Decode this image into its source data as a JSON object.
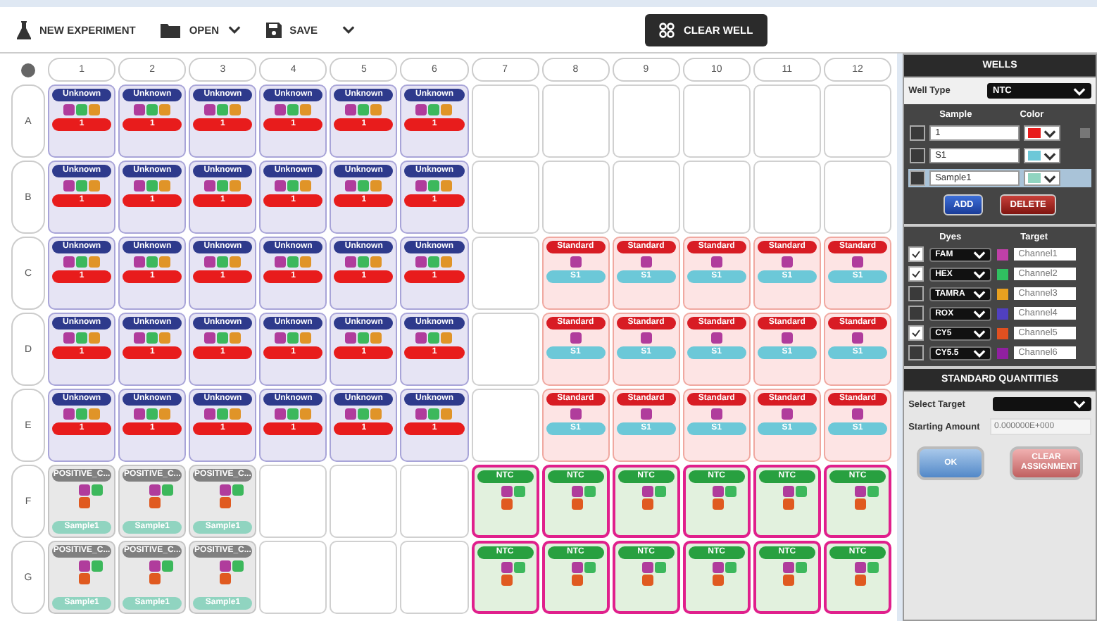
{
  "toolbar": {
    "new_experiment": "NEW EXPERIMENT",
    "open": "OPEN",
    "save": "SAVE",
    "clear_well": "CLEAR WELL"
  },
  "plate": {
    "columns": [
      "1",
      "2",
      "3",
      "4",
      "5",
      "6",
      "7",
      "8",
      "9",
      "10",
      "11",
      "12"
    ],
    "rows": [
      {
        "label": "A",
        "wells": [
          {
            "kind": "unknown",
            "label": "Unknown",
            "dyes": [
              {
                "color": "#b03c9c"
              },
              {
                "color": "#3cb85c"
              },
              {
                "color": "#e09428"
              }
            ],
            "tag": "1"
          },
          {
            "kind": "unknown",
            "label": "Unknown",
            "dyes": [
              {
                "color": "#b03c9c"
              },
              {
                "color": "#3cb85c"
              },
              {
                "color": "#e09428"
              }
            ],
            "tag": "1"
          },
          {
            "kind": "unknown",
            "label": "Unknown",
            "dyes": [
              {
                "color": "#b03c9c"
              },
              {
                "color": "#3cb85c"
              },
              {
                "color": "#e09428"
              }
            ],
            "tag": "1"
          },
          {
            "kind": "unknown",
            "label": "Unknown",
            "dyes": [
              {
                "color": "#b03c9c"
              },
              {
                "color": "#3cb85c"
              },
              {
                "color": "#e09428"
              }
            ],
            "tag": "1"
          },
          {
            "kind": "unknown",
            "label": "Unknown",
            "dyes": [
              {
                "color": "#b03c9c"
              },
              {
                "color": "#3cb85c"
              },
              {
                "color": "#e09428"
              }
            ],
            "tag": "1"
          },
          {
            "kind": "unknown",
            "label": "Unknown",
            "dyes": [
              {
                "color": "#b03c9c"
              },
              {
                "color": "#3cb85c"
              },
              {
                "color": "#e09428"
              }
            ],
            "tag": "1"
          },
          {
            "kind": "empty"
          },
          {
            "kind": "empty"
          },
          {
            "kind": "empty"
          },
          {
            "kind": "empty"
          },
          {
            "kind": "empty"
          },
          {
            "kind": "empty"
          }
        ]
      },
      {
        "label": "B",
        "wells": [
          {
            "kind": "unknown",
            "label": "Unknown",
            "dyes": [
              {
                "color": "#b03c9c"
              },
              {
                "color": "#3cb85c"
              },
              {
                "color": "#e09428"
              }
            ],
            "tag": "1"
          },
          {
            "kind": "unknown",
            "label": "Unknown",
            "dyes": [
              {
                "color": "#b03c9c"
              },
              {
                "color": "#3cb85c"
              },
              {
                "color": "#e09428"
              }
            ],
            "tag": "1"
          },
          {
            "kind": "unknown",
            "label": "Unknown",
            "dyes": [
              {
                "color": "#b03c9c"
              },
              {
                "color": "#3cb85c"
              },
              {
                "color": "#e09428"
              }
            ],
            "tag": "1"
          },
          {
            "kind": "unknown",
            "label": "Unknown",
            "dyes": [
              {
                "color": "#b03c9c"
              },
              {
                "color": "#3cb85c"
              },
              {
                "color": "#e09428"
              }
            ],
            "tag": "1"
          },
          {
            "kind": "unknown",
            "label": "Unknown",
            "dyes": [
              {
                "color": "#b03c9c"
              },
              {
                "color": "#3cb85c"
              },
              {
                "color": "#e09428"
              }
            ],
            "tag": "1"
          },
          {
            "kind": "unknown",
            "label": "Unknown",
            "dyes": [
              {
                "color": "#b03c9c"
              },
              {
                "color": "#3cb85c"
              },
              {
                "color": "#e09428"
              }
            ],
            "tag": "1"
          },
          {
            "kind": "empty"
          },
          {
            "kind": "empty"
          },
          {
            "kind": "empty"
          },
          {
            "kind": "empty"
          },
          {
            "kind": "empty"
          },
          {
            "kind": "empty"
          }
        ]
      },
      {
        "label": "C",
        "wells": [
          {
            "kind": "unknown",
            "label": "Unknown",
            "dyes": [
              {
                "color": "#b03c9c"
              },
              {
                "color": "#3cb85c"
              },
              {
                "color": "#e09428"
              }
            ],
            "tag": "1"
          },
          {
            "kind": "unknown",
            "label": "Unknown",
            "dyes": [
              {
                "color": "#b03c9c"
              },
              {
                "color": "#3cb85c"
              },
              {
                "color": "#e09428"
              }
            ],
            "tag": "1"
          },
          {
            "kind": "unknown",
            "label": "Unknown",
            "dyes": [
              {
                "color": "#b03c9c"
              },
              {
                "color": "#3cb85c"
              },
              {
                "color": "#e09428"
              }
            ],
            "tag": "1"
          },
          {
            "kind": "unknown",
            "label": "Unknown",
            "dyes": [
              {
                "color": "#b03c9c"
              },
              {
                "color": "#3cb85c"
              },
              {
                "color": "#e09428"
              }
            ],
            "tag": "1"
          },
          {
            "kind": "unknown",
            "label": "Unknown",
            "dyes": [
              {
                "color": "#b03c9c"
              },
              {
                "color": "#3cb85c"
              },
              {
                "color": "#e09428"
              }
            ],
            "tag": "1"
          },
          {
            "kind": "unknown",
            "label": "Unknown",
            "dyes": [
              {
                "color": "#b03c9c"
              },
              {
                "color": "#3cb85c"
              },
              {
                "color": "#e09428"
              }
            ],
            "tag": "1"
          },
          {
            "kind": "empty"
          },
          {
            "kind": "standard",
            "label": "Standard",
            "dyes": [
              {
                "color": "#b03c9c"
              }
            ],
            "tag": "S1"
          },
          {
            "kind": "standard",
            "label": "Standard",
            "dyes": [
              {
                "color": "#b03c9c"
              }
            ],
            "tag": "S1"
          },
          {
            "kind": "standard",
            "label": "Standard",
            "dyes": [
              {
                "color": "#b03c9c"
              }
            ],
            "tag": "S1"
          },
          {
            "kind": "standard",
            "label": "Standard",
            "dyes": [
              {
                "color": "#b03c9c"
              }
            ],
            "tag": "S1"
          },
          {
            "kind": "standard",
            "label": "Standard",
            "dyes": [
              {
                "color": "#b03c9c"
              }
            ],
            "tag": "S1"
          }
        ]
      },
      {
        "label": "D",
        "wells": [
          {
            "kind": "unknown",
            "label": "Unknown",
            "dyes": [
              {
                "color": "#b03c9c"
              },
              {
                "color": "#3cb85c"
              },
              {
                "color": "#e09428"
              }
            ],
            "tag": "1"
          },
          {
            "kind": "unknown",
            "label": "Unknown",
            "dyes": [
              {
                "color": "#b03c9c"
              },
              {
                "color": "#3cb85c"
              },
              {
                "color": "#e09428"
              }
            ],
            "tag": "1"
          },
          {
            "kind": "unknown",
            "label": "Unknown",
            "dyes": [
              {
                "color": "#b03c9c"
              },
              {
                "color": "#3cb85c"
              },
              {
                "color": "#e09428"
              }
            ],
            "tag": "1"
          },
          {
            "kind": "unknown",
            "label": "Unknown",
            "dyes": [
              {
                "color": "#b03c9c"
              },
              {
                "color": "#3cb85c"
              },
              {
                "color": "#e09428"
              }
            ],
            "tag": "1"
          },
          {
            "kind": "unknown",
            "label": "Unknown",
            "dyes": [
              {
                "color": "#b03c9c"
              },
              {
                "color": "#3cb85c"
              },
              {
                "color": "#e09428"
              }
            ],
            "tag": "1"
          },
          {
            "kind": "unknown",
            "label": "Unknown",
            "dyes": [
              {
                "color": "#b03c9c"
              },
              {
                "color": "#3cb85c"
              },
              {
                "color": "#e09428"
              }
            ],
            "tag": "1"
          },
          {
            "kind": "empty"
          },
          {
            "kind": "standard",
            "label": "Standard",
            "dyes": [
              {
                "color": "#b03c9c"
              }
            ],
            "tag": "S1"
          },
          {
            "kind": "standard",
            "label": "Standard",
            "dyes": [
              {
                "color": "#b03c9c"
              }
            ],
            "tag": "S1"
          },
          {
            "kind": "standard",
            "label": "Standard",
            "dyes": [
              {
                "color": "#b03c9c"
              }
            ],
            "tag": "S1"
          },
          {
            "kind": "standard",
            "label": "Standard",
            "dyes": [
              {
                "color": "#b03c9c"
              }
            ],
            "tag": "S1"
          },
          {
            "kind": "standard",
            "label": "Standard",
            "dyes": [
              {
                "color": "#b03c9c"
              }
            ],
            "tag": "S1"
          }
        ]
      },
      {
        "label": "E",
        "wells": [
          {
            "kind": "unknown",
            "label": "Unknown",
            "dyes": [
              {
                "color": "#b03c9c"
              },
              {
                "color": "#3cb85c"
              },
              {
                "color": "#e09428"
              }
            ],
            "tag": "1"
          },
          {
            "kind": "unknown",
            "label": "Unknown",
            "dyes": [
              {
                "color": "#b03c9c"
              },
              {
                "color": "#3cb85c"
              },
              {
                "color": "#e09428"
              }
            ],
            "tag": "1"
          },
          {
            "kind": "unknown",
            "label": "Unknown",
            "dyes": [
              {
                "color": "#b03c9c"
              },
              {
                "color": "#3cb85c"
              },
              {
                "color": "#e09428"
              }
            ],
            "tag": "1"
          },
          {
            "kind": "unknown",
            "label": "Unknown",
            "dyes": [
              {
                "color": "#b03c9c"
              },
              {
                "color": "#3cb85c"
              },
              {
                "color": "#e09428"
              }
            ],
            "tag": "1"
          },
          {
            "kind": "unknown",
            "label": "Unknown",
            "dyes": [
              {
                "color": "#b03c9c"
              },
              {
                "color": "#3cb85c"
              },
              {
                "color": "#e09428"
              }
            ],
            "tag": "1"
          },
          {
            "kind": "unknown",
            "label": "Unknown",
            "dyes": [
              {
                "color": "#b03c9c"
              },
              {
                "color": "#3cb85c"
              },
              {
                "color": "#e09428"
              }
            ],
            "tag": "1"
          },
          {
            "kind": "empty"
          },
          {
            "kind": "standard",
            "label": "Standard",
            "dyes": [
              {
                "color": "#b03c9c"
              }
            ],
            "tag": "S1"
          },
          {
            "kind": "standard",
            "label": "Standard",
            "dyes": [
              {
                "color": "#b03c9c"
              }
            ],
            "tag": "S1"
          },
          {
            "kind": "standard",
            "label": "Standard",
            "dyes": [
              {
                "color": "#b03c9c"
              }
            ],
            "tag": "S1"
          },
          {
            "kind": "standard",
            "label": "Standard",
            "dyes": [
              {
                "color": "#b03c9c"
              }
            ],
            "tag": "S1"
          },
          {
            "kind": "standard",
            "label": "Standard",
            "dyes": [
              {
                "color": "#b03c9c"
              }
            ],
            "tag": "S1"
          }
        ]
      },
      {
        "label": "F",
        "wells": [
          {
            "kind": "positive",
            "label": "POSITIVE_C...",
            "dyes": [
              {
                "color": "#b03c9c"
              },
              {
                "color": "#3cb85c"
              },
              {
                "color": "#e05a20"
              }
            ],
            "tag": "Sample1"
          },
          {
            "kind": "positive",
            "label": "POSITIVE_C...",
            "dyes": [
              {
                "color": "#b03c9c"
              },
              {
                "color": "#3cb85c"
              },
              {
                "color": "#e05a20"
              }
            ],
            "tag": "Sample1"
          },
          {
            "kind": "positive",
            "label": "POSITIVE_C...",
            "dyes": [
              {
                "color": "#b03c9c"
              },
              {
                "color": "#3cb85c"
              },
              {
                "color": "#e05a20"
              }
            ],
            "tag": "Sample1"
          },
          {
            "kind": "empty"
          },
          {
            "kind": "empty"
          },
          {
            "kind": "empty"
          },
          {
            "kind": "ntc",
            "label": "NTC",
            "dyes": [
              {
                "color": "#b03c9c"
              },
              {
                "color": "#3cb85c"
              },
              {
                "color": "#e05a20"
              }
            ]
          },
          {
            "kind": "ntc",
            "label": "NTC",
            "dyes": [
              {
                "color": "#b03c9c"
              },
              {
                "color": "#3cb85c"
              },
              {
                "color": "#e05a20"
              }
            ]
          },
          {
            "kind": "ntc",
            "label": "NTC",
            "dyes": [
              {
                "color": "#b03c9c"
              },
              {
                "color": "#3cb85c"
              },
              {
                "color": "#e05a20"
              }
            ]
          },
          {
            "kind": "ntc",
            "label": "NTC",
            "dyes": [
              {
                "color": "#b03c9c"
              },
              {
                "color": "#3cb85c"
              },
              {
                "color": "#e05a20"
              }
            ]
          },
          {
            "kind": "ntc",
            "label": "NTC",
            "dyes": [
              {
                "color": "#b03c9c"
              },
              {
                "color": "#3cb85c"
              },
              {
                "color": "#e05a20"
              }
            ]
          },
          {
            "kind": "ntc",
            "label": "NTC",
            "dyes": [
              {
                "color": "#b03c9c"
              },
              {
                "color": "#3cb85c"
              },
              {
                "color": "#e05a20"
              }
            ]
          }
        ]
      },
      {
        "label": "G",
        "wells": [
          {
            "kind": "positive",
            "label": "POSITIVE_C...",
            "dyes": [
              {
                "color": "#b03c9c"
              },
              {
                "color": "#3cb85c"
              },
              {
                "color": "#e05a20"
              }
            ],
            "tag": "Sample1"
          },
          {
            "kind": "positive",
            "label": "POSITIVE_C...",
            "dyes": [
              {
                "color": "#b03c9c"
              },
              {
                "color": "#3cb85c"
              },
              {
                "color": "#e05a20"
              }
            ],
            "tag": "Sample1"
          },
          {
            "kind": "positive",
            "label": "POSITIVE_C...",
            "dyes": [
              {
                "color": "#b03c9c"
              },
              {
                "color": "#3cb85c"
              },
              {
                "color": "#e05a20"
              }
            ],
            "tag": "Sample1"
          },
          {
            "kind": "empty"
          },
          {
            "kind": "empty"
          },
          {
            "kind": "empty"
          },
          {
            "kind": "ntc",
            "label": "NTC",
            "dyes": [
              {
                "color": "#b03c9c"
              },
              {
                "color": "#3cb85c"
              },
              {
                "color": "#e05a20"
              }
            ]
          },
          {
            "kind": "ntc",
            "label": "NTC",
            "dyes": [
              {
                "color": "#b03c9c"
              },
              {
                "color": "#3cb85c"
              },
              {
                "color": "#e05a20"
              }
            ]
          },
          {
            "kind": "ntc",
            "label": "NTC",
            "dyes": [
              {
                "color": "#b03c9c"
              },
              {
                "color": "#3cb85c"
              },
              {
                "color": "#e05a20"
              }
            ]
          },
          {
            "kind": "ntc",
            "label": "NTC",
            "dyes": [
              {
                "color": "#b03c9c"
              },
              {
                "color": "#3cb85c"
              },
              {
                "color": "#e05a20"
              }
            ]
          },
          {
            "kind": "ntc",
            "label": "NTC",
            "dyes": [
              {
                "color": "#b03c9c"
              },
              {
                "color": "#3cb85c"
              },
              {
                "color": "#e05a20"
              }
            ]
          },
          {
            "kind": "ntc",
            "label": "NTC",
            "dyes": [
              {
                "color": "#b03c9c"
              },
              {
                "color": "#3cb85c"
              },
              {
                "color": "#e05a20"
              }
            ]
          }
        ]
      }
    ]
  },
  "wells_panel": {
    "title": "WELLS",
    "well_type_label": "Well Type",
    "well_type": "NTC",
    "sample_header": "Sample",
    "color_header": "Color",
    "samples": [
      {
        "name": "1",
        "color": "#e81c1c",
        "checked": false,
        "selected": false
      },
      {
        "name": "S1",
        "color": "#6cc8d8",
        "checked": false,
        "selected": false
      },
      {
        "name": "Sample1",
        "color": "#90d4c0",
        "checked": false,
        "selected": true
      }
    ],
    "add": "ADD",
    "delete": "DELETE",
    "dyes_header": "Dyes",
    "target_header": "Target",
    "dyes": [
      {
        "dye": "FAM",
        "color": "#c040a8",
        "target": "Channel1",
        "checked": true
      },
      {
        "dye": "HEX",
        "color": "#30c060",
        "target": "Channel2",
        "checked": true
      },
      {
        "dye": "TAMRA",
        "color": "#e8a020",
        "target": "Channel3",
        "checked": false
      },
      {
        "dye": "ROX",
        "color": "#5040c0",
        "target": "Channel4",
        "checked": false
      },
      {
        "dye": "CY5",
        "color": "#e05020",
        "target": "Channel5",
        "checked": true
      },
      {
        "dye": "CY5.5",
        "color": "#9020a0",
        "target": "Channel6",
        "checked": false
      }
    ]
  },
  "standard_quantities": {
    "title": "STANDARD QUANTITIES",
    "select_target_label": "Select Target",
    "starting_amount_label": "Starting Amount",
    "starting_amount_placeholder": "0.000000E+000",
    "ok": "OK",
    "clear_assignment": "CLEAR ASSIGNMENT"
  }
}
